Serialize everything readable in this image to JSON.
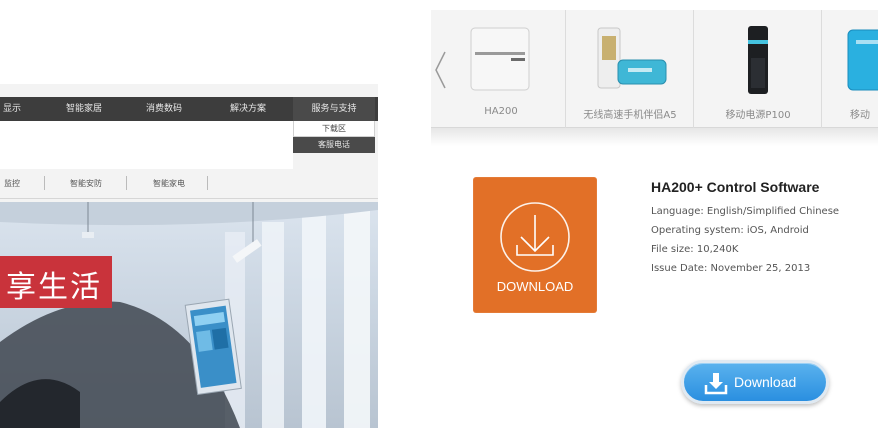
{
  "left_site": {
    "nav": {
      "items": [
        "显示",
        "智能家居",
        "消费数码",
        "解决方案",
        "服务与支持"
      ],
      "dropdown": [
        "下载区",
        "客服电话"
      ]
    },
    "subnav": [
      "监控",
      "智能安防",
      "智能家电"
    ],
    "banner_text": "享生活"
  },
  "right_site": {
    "carousel": {
      "prev_icon": "chevron-left-icon",
      "products": [
        {
          "label": "HA200",
          "icon": "router-icon"
        },
        {
          "label": "无线高速手机伴侣A5",
          "icon": "power-bank-icon"
        },
        {
          "label": "移动电源P100",
          "icon": "power-bank-icon"
        },
        {
          "label": "移动",
          "icon": "power-bank-icon"
        }
      ]
    },
    "software": {
      "tile_label": "DOWNLOAD",
      "tile_icon": "download-circle-icon",
      "title": "HA200+ Control Software",
      "language": "Language: English/Simplified Chinese",
      "os": "Operating system: iOS, Android",
      "size": "File size: 10,240K",
      "date": "Issue Date: November 25, 2013",
      "button_label": "Download",
      "button_icon": "download-tray-icon"
    },
    "colors": {
      "tile_orange": "#e27027",
      "button_blue": "#2a8fe0",
      "nav_dark": "#3d3d3d",
      "banner_red": "#c9333b"
    }
  }
}
